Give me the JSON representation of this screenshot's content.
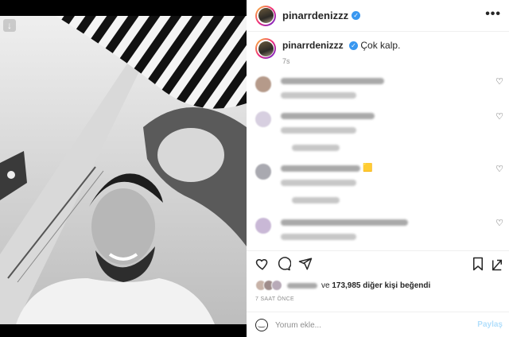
{
  "media": {
    "download_icon": "arrow-down-icon"
  },
  "header": {
    "username": "pinarrdenizzz",
    "verified_icon": "verified-badge-icon",
    "more_icon": "more-horizontal-icon",
    "more_label": "•••"
  },
  "caption": {
    "username": "pinarrdenizzz",
    "text": "Çok kalp.",
    "time": "7s"
  },
  "comments": [
    {
      "username": "pxyjk_aeddqfe",
      "text": "lkhgxytsn",
      "meta": [
        "1h",
        "4b1 beğenme",
        "Yanıtla"
      ]
    },
    {
      "username": "eqgawdc",
      "text": "lkhgxytsn lklnn kklz",
      "meta": [
        "1h",
        "1b3 beğenme",
        "Yanıtla"
      ],
      "replies": "Yanıtları gör (1)"
    },
    {
      "username": "bmshrfsz",
      "text": "jnhwjr Duzuk",
      "meta": [
        "1h",
        "1b1 beğenme",
        "Yanıtla"
      ],
      "replies": "Yanıtları gör (1)"
    },
    {
      "username": "knsapk_bwedfr",
      "text": "klnrng aybfhe lkneer",
      "meta": [
        "1h",
        "1b9 beğenme",
        "Yanıtla"
      ]
    }
  ],
  "actions": {
    "like_icon": "heart-icon",
    "comment_icon": "comment-icon",
    "share_icon": "send-icon",
    "save_icon": "bookmark-icon"
  },
  "likes": {
    "prefix": "ve",
    "count": "173,985",
    "suffix": "diğer kişi beğendi"
  },
  "posted": "7 SAAT ÖNCE",
  "add_comment": {
    "emoji_icon": "smiley-icon",
    "placeholder": "Yorum ekle...",
    "submit_label": "Paylaş"
  },
  "colors": {
    "accent_blue": "#0095f6",
    "share_disabled": "#b2dffc",
    "verified": "#3897f0"
  }
}
